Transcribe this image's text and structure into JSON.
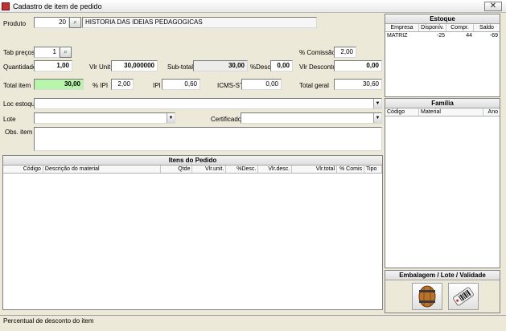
{
  "window": {
    "title": "Cadastro de item de pedido",
    "close": "✕"
  },
  "produto": {
    "label": "Produto",
    "code": "20",
    "name": "HISTORIA DAS IDEIAS PEDAGOGICAS"
  },
  "tab_precos": {
    "label": "Tab preços",
    "value": "1"
  },
  "comissao": {
    "label": "% Comissão",
    "value": "2,00"
  },
  "quantidade": {
    "label": "Quantidade",
    "value": "1,00"
  },
  "vlr_unit": {
    "label": "Vlr Unit",
    "value": "30,000000"
  },
  "sub_total": {
    "label": "Sub-total",
    "value": "30,00"
  },
  "desc": {
    "label": "%Desc",
    "value": "0,00"
  },
  "vlr_desconto": {
    "label": "Vlr Desconto",
    "value": "0,00"
  },
  "total_item": {
    "label": "Total item",
    "value": "30,00"
  },
  "ipi_pct": {
    "label": "% IPI",
    "value": "2,00"
  },
  "ipi": {
    "label": "IPI",
    "value": "0,60"
  },
  "icms_st": {
    "label": "ICMS-ST",
    "value": "0,00"
  },
  "total_geral": {
    "label": "Total geral",
    "value": "30,60"
  },
  "loc_estoque": {
    "label": "Loc estoque",
    "value": ""
  },
  "lote": {
    "label": "Lote",
    "value": ""
  },
  "certificado": {
    "label": "Certificado",
    "value": ""
  },
  "obs_item": {
    "label": "Obs. item",
    "value": ""
  },
  "estoque": {
    "title": "Estoque",
    "columns": [
      "Empresa",
      "Disponív.",
      "Compr.",
      "Saldo"
    ],
    "rows": [
      [
        "MATRIZ",
        "-25",
        "44",
        "-69"
      ]
    ]
  },
  "familia": {
    "title": "Família",
    "columns": [
      "Código",
      "Material",
      "Ano"
    ]
  },
  "itens": {
    "title": "Itens do Pedido",
    "columns": [
      "Código",
      "Descrição do material",
      "Qtde",
      "Vlr.unit.",
      "%Desc.",
      "Vlr.desc.",
      "Vlr.total",
      "% Comis",
      "Tipo"
    ]
  },
  "embalagem": {
    "title": "Embalagem / Lote / Validade"
  },
  "status": {
    "text": "Percentual de desconto do item"
  },
  "icons": {
    "lookup": "search-icon",
    "barrel": "barrel-icon",
    "tag": "barcode-tag-icon"
  }
}
